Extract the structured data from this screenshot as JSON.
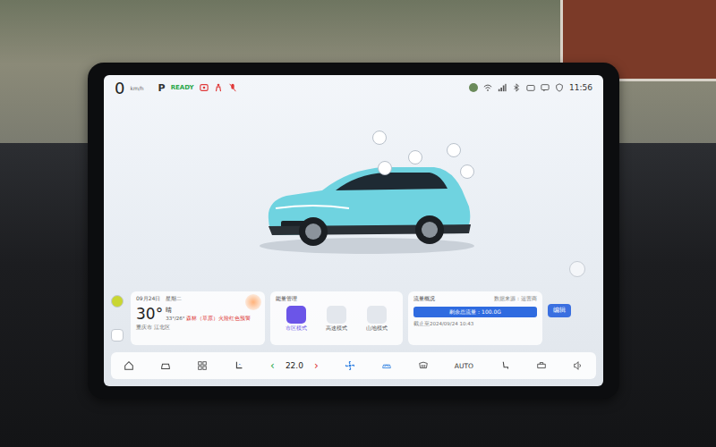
{
  "status_bar": {
    "speed": "0",
    "speed_unit": "km/h",
    "gear": "P",
    "ready": "READY",
    "time": "11:56"
  },
  "weather": {
    "date": "09月24日",
    "weekday": "星期二",
    "temp": "30°",
    "condition": "晴",
    "range": "33°/26°",
    "alert": "森林（草原）火险红色预警",
    "location": "重庆市 江北区"
  },
  "energy": {
    "title": "能量管理",
    "modes": [
      {
        "label": "市区模式",
        "selected": true
      },
      {
        "label": "高速模式",
        "selected": false
      },
      {
        "label": "山地模式",
        "selected": false
      }
    ]
  },
  "data_usage": {
    "title": "流量概况",
    "source": "数据来源：运营商",
    "remaining": "剩余总流量：100.0G",
    "level": 1,
    "deadline": "截止至2024/09/24 10:43"
  },
  "edit_button": "编辑",
  "climate": {
    "decrease": "‹",
    "temperature": "22.0",
    "increase": "›",
    "auto": "AUTO"
  }
}
